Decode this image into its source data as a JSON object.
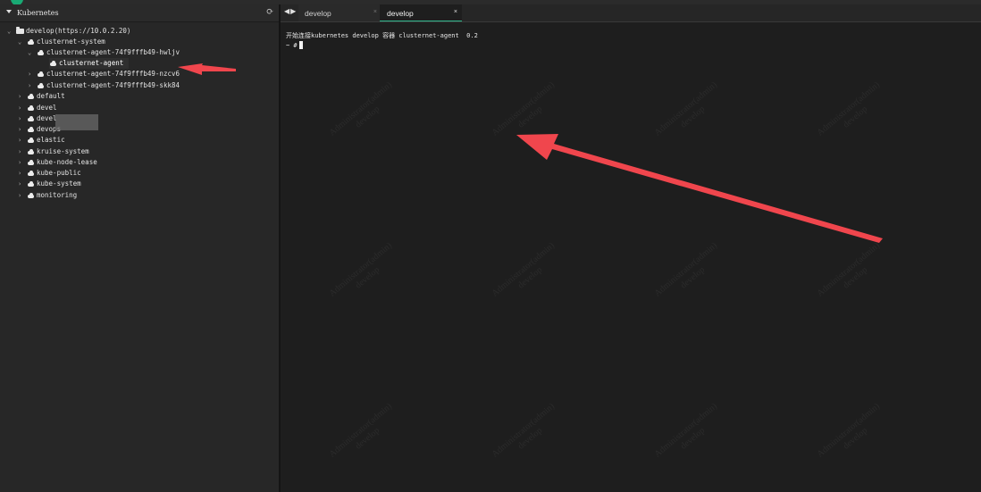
{
  "sidebar": {
    "title": "Kubernetes",
    "tree": {
      "root": "develop(https://10.0.2.20)",
      "namespace_open": "clusternet-system",
      "pod_open": "clusternet-agent-74f9fffb49-hwljv",
      "container": "clusternet-agent",
      "pods_other": [
        "clusternet-agent-74f9fffb49-nzcv6",
        "clusternet-agent-74f9fffb49-skk84"
      ],
      "namespaces": [
        "default",
        "devel",
        "devel",
        "devops",
        "elastic",
        "kruise-system",
        "kube-node-lease",
        "kube-public",
        "kube-system",
        "monitoring"
      ]
    }
  },
  "tabs": [
    {
      "label": "develop",
      "close": "×"
    },
    {
      "label": "develop",
      "close": "×"
    }
  ],
  "terminal": {
    "line1": "开始连接kubernetes develop 容器 clusternet-agent  0.2",
    "prompt": "~ #"
  },
  "watermark": {
    "line1": "Administrator(admin)",
    "line2": "develop"
  },
  "icons": {
    "refresh": "refresh-icon",
    "nav": "nav-arrows-icon",
    "cloud": "cloud-icon",
    "folder": "folder-icon"
  },
  "colors": {
    "accent": "#2db38a",
    "arrow": "#f0464d",
    "background": "#1e1e1e",
    "sidebar": "#272727"
  }
}
